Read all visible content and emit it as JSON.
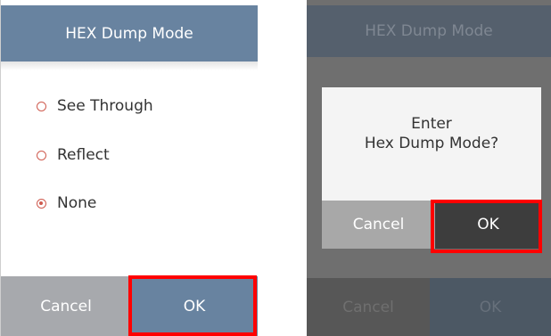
{
  "left": {
    "title": "HEX Dump Mode",
    "options": [
      {
        "label": "See Through",
        "selected": false
      },
      {
        "label": "Reflect",
        "selected": false
      },
      {
        "label": "None",
        "selected": true
      }
    ],
    "cancel_label": "Cancel",
    "ok_label": "OK"
  },
  "right": {
    "title": "HEX Dump Mode",
    "dialog": {
      "line1": "Enter",
      "line2": "Hex Dump Mode?",
      "cancel_label": "Cancel",
      "ok_label": "OK"
    },
    "cancel_label": "Cancel",
    "ok_label": "OK"
  },
  "colors": {
    "header": "#6883a0",
    "radio_accent": "#cf5b4f",
    "highlight": "#ff0000"
  }
}
